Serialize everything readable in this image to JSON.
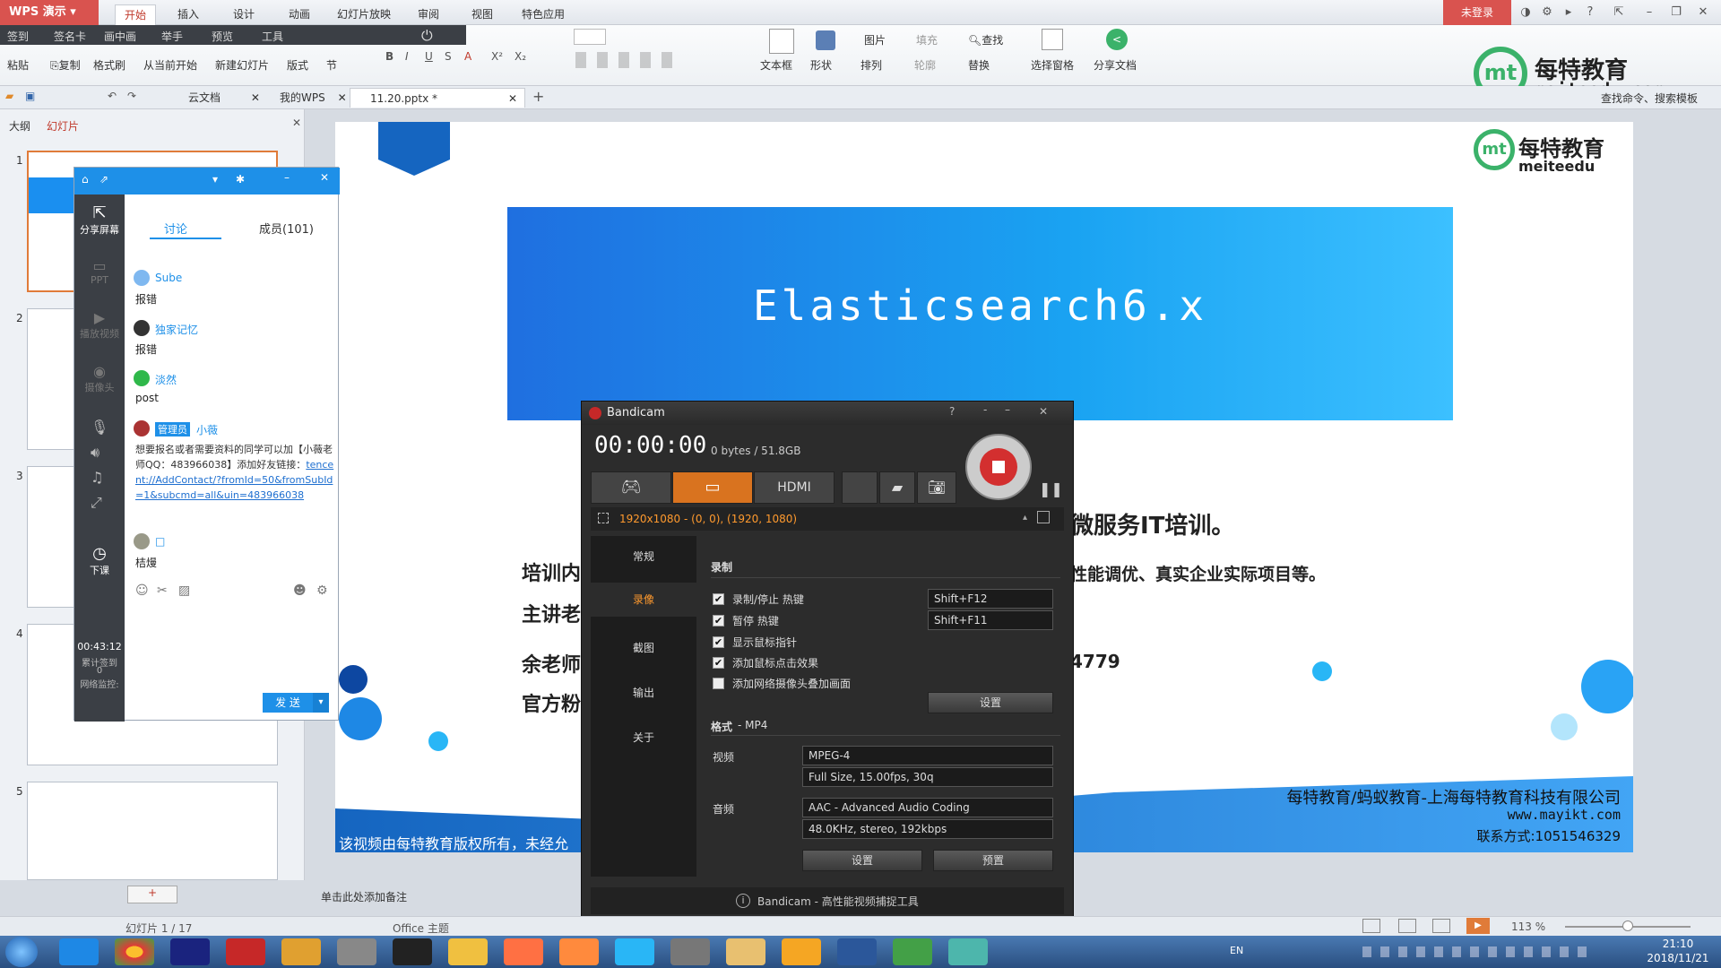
{
  "app": {
    "name": "WPS 演示",
    "menu_tabs": [
      "开始",
      "插入",
      "设计",
      "动画",
      "幻灯片放映",
      "审阅",
      "视图",
      "特色应用"
    ],
    "active_tab": "开始",
    "login": "未登录"
  },
  "ribbon_row1": [
    "签到",
    "签名卡",
    "画中画",
    "举手",
    "预览",
    "工具"
  ],
  "ribbon": {
    "paste": "粘贴",
    "copy": "复制",
    "format_painter": "格式刷",
    "from_current": "从当前开始",
    "new_slide": "新建幻灯片",
    "layout": "版式",
    "section": "节",
    "textbox": "文本框",
    "shape": "形状",
    "arrange": "排列",
    "image": "图片",
    "fill": "填充",
    "outline": "轮廓",
    "find": "查找",
    "replace": "替换",
    "select_pane": "选择窗格",
    "share_doc": "分享文档",
    "search_cmd": "查找命令、搜索模板"
  },
  "doc_tabs": [
    {
      "label": "云文档"
    },
    {
      "label": "我的WPS"
    },
    {
      "label": "11.20.pptx *"
    }
  ],
  "left_panel": {
    "tab_outline": "大纲",
    "tab_slides": "幻灯片",
    "slide_numbers": [
      "1",
      "2",
      "3",
      "4",
      "5"
    ]
  },
  "chat": {
    "tab_discuss": "讨论",
    "tab_members": "成员(101)",
    "side_items": [
      "分享屏幕",
      "PPT",
      "播放视频",
      "摄像头",
      "下课"
    ],
    "timer": "00:43:12",
    "side_stats": [
      "累计签到",
      "0",
      "网络监控:"
    ],
    "messages": [
      {
        "user": "Sube",
        "text": "报错"
      },
      {
        "user": "独家记忆",
        "text": "报错"
      },
      {
        "user": "淡然",
        "text": "post"
      },
      {
        "user": "小薇",
        "badge": "管理员",
        "text": "想要报名或者需要资料的同学可以加【小薇老师QQ：483966038】添加好友链接：",
        "link": "tencent://AddContact/?fromId=50&fromSubId=1&subcmd=all&uin=483966038"
      },
      {
        "user": "□",
        "text": "桔熳"
      }
    ],
    "send": "发 送"
  },
  "slide": {
    "logo_cn": "每特教育",
    "logo_en": "meiteedu",
    "title": "Elasticsearch6.x",
    "line1_tail": "微服务IT培训。",
    "line2_head": "培训内",
    "line2_tail": "性能调优、真实企业实际项目等。",
    "line3_head": "主讲老",
    "line4_head": "余老师",
    "line4_tail": "4779",
    "line5_head": "官方粉",
    "footer_company": "每特教育/蚂蚁教育-上海每特教育科技有限公司",
    "footer_url": "www.mayikt.com",
    "footer_contact": "联系方式:1051546329",
    "copyright": "该视频由每特教育版权所有，未经允"
  },
  "corner_logo": {
    "cn": "每特教育",
    "en": "meiteedu.com"
  },
  "notes_placeholder": "单击此处添加备注",
  "status": {
    "slide_of": "幻灯片 1 / 17",
    "theme": "Office 主题",
    "zoom": "113 %"
  },
  "bandicam": {
    "title": "Bandicam",
    "timer": "00:00:00",
    "size": "0 bytes / 51.8GB",
    "region": "1920x1080 - (0, 0), (1920, 1080)",
    "nav": [
      "常规",
      "录像",
      "截图",
      "输出",
      "关于"
    ],
    "active_nav": "录像",
    "section_record": "录制",
    "options": [
      {
        "label": "录制/停止 热键",
        "checked": true,
        "hotkey": "Shift+F12"
      },
      {
        "label": "暂停 热键",
        "checked": true,
        "hotkey": "Shift+F11"
      },
      {
        "label": "显示鼠标指针",
        "checked": true
      },
      {
        "label": "添加鼠标点击效果",
        "checked": true
      },
      {
        "label": "添加网络摄像头叠加画面",
        "checked": false
      }
    ],
    "settings_btn": "设置",
    "format_label": "格式",
    "format_value": "- MP4",
    "video_label": "视频",
    "video_codec": "MPEG-4",
    "video_detail": "Full Size, 15.00fps, 30q",
    "audio_label": "音频",
    "audio_codec": "AAC - Advanced Audio Coding",
    "audio_detail": "48.0KHz, stereo, 192kbps",
    "btn_settings": "设置",
    "btn_preset": "预置",
    "footer": "Bandicam - 高性能视频捕捉工具"
  },
  "taskbar": {
    "lang": "EN",
    "time": "21:10",
    "date": "2018/11/21"
  }
}
